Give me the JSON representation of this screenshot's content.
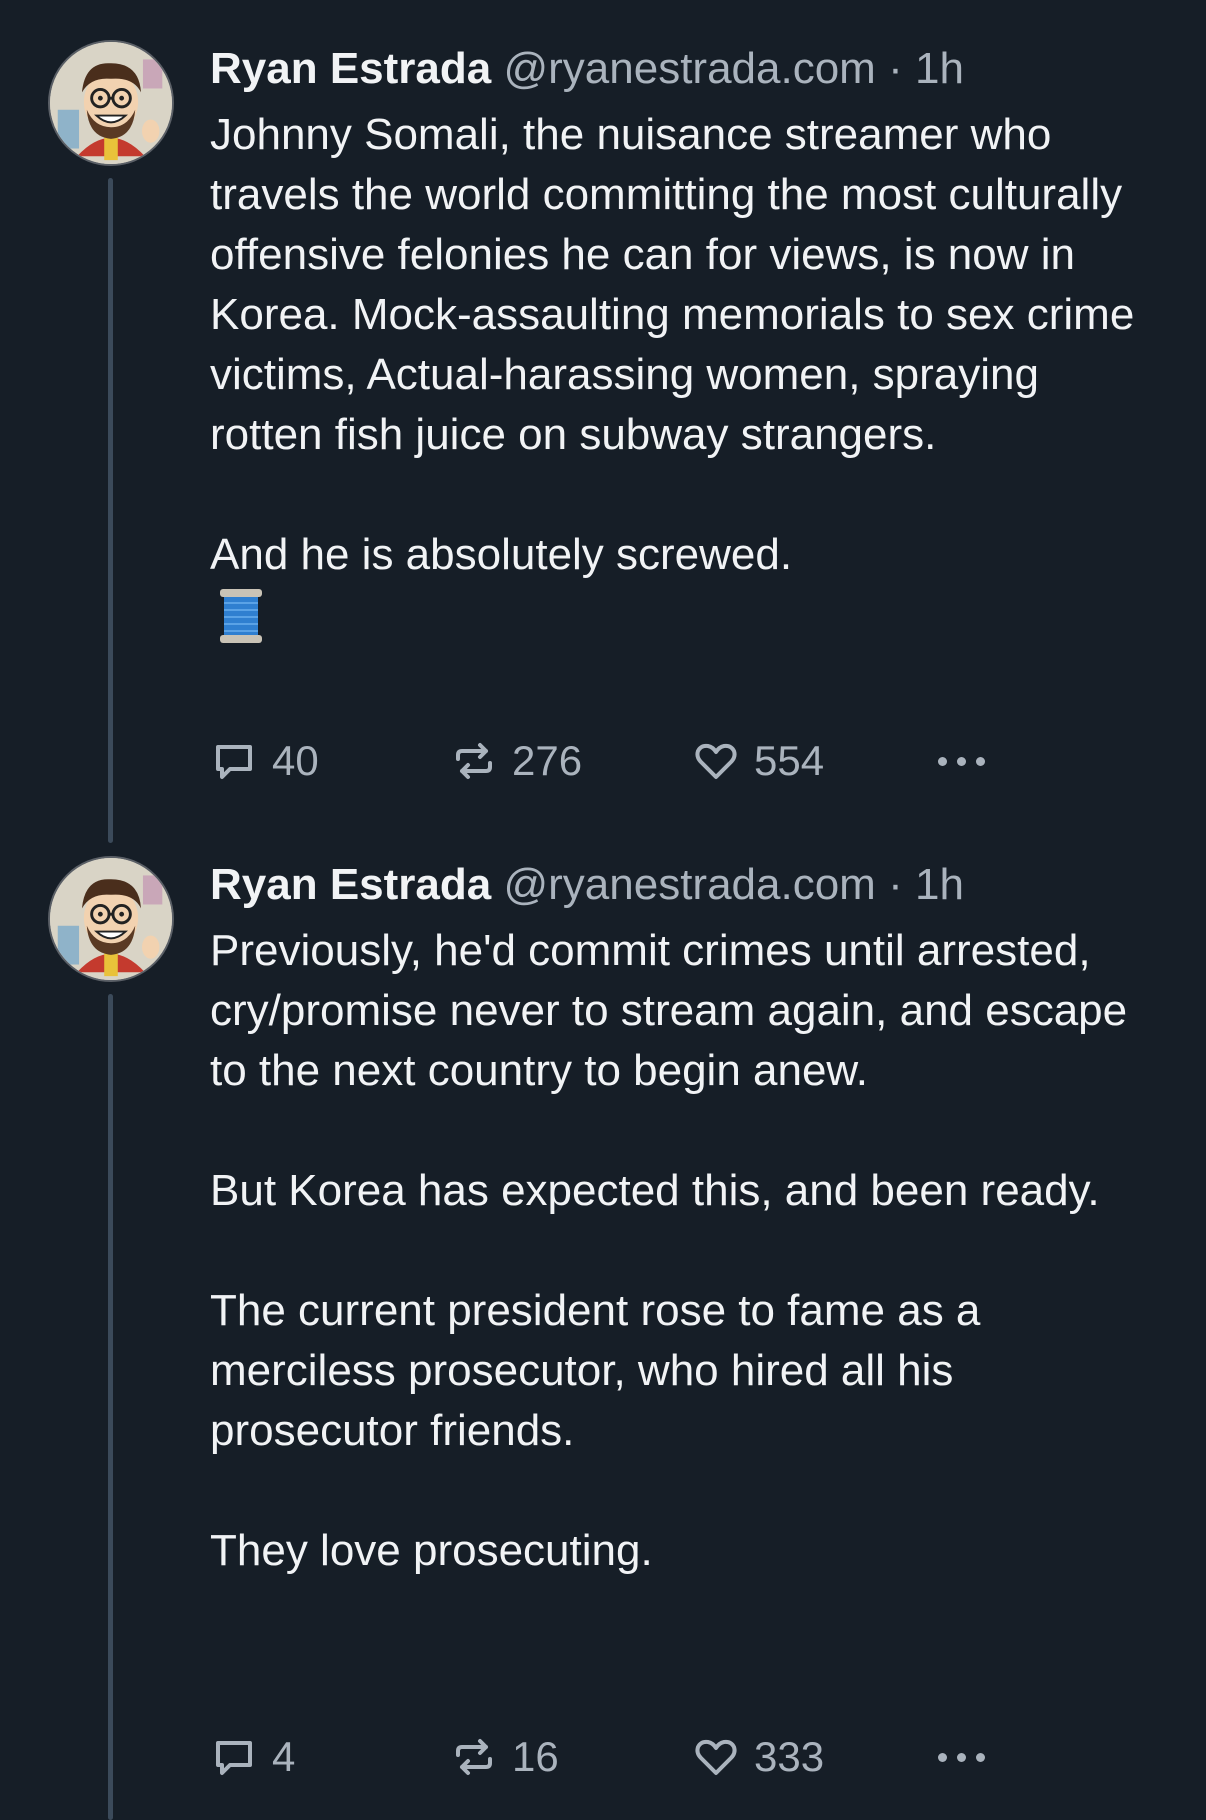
{
  "posts": [
    {
      "author_name": "Ryan Estrada",
      "handle": "@ryanestrada.com",
      "separator": "·",
      "time": "1h",
      "paragraphs": [
        "Johnny Somali, the nuisance streamer who travels the world committing the most culturally offensive felonies he can for views, is now in Korea. Mock-assaulting memorials to sex crime victims, Actual-harassing women, spraying rotten fish juice on subway strangers.",
        "And he is absolutely screwed."
      ],
      "emoji": "spool-of-thread-icon",
      "replies": "40",
      "reposts": "276",
      "likes": "554"
    },
    {
      "author_name": "Ryan Estrada",
      "handle": "@ryanestrada.com",
      "separator": "·",
      "time": "1h",
      "paragraphs": [
        "Previously, he'd commit crimes until arrested, cry/promise never to stream again, and escape to the next country to begin anew.",
        "But Korea has expected this, and been ready.",
        "The current president rose to fame as a merciless prosecutor, who hired all his prosecutor friends.",
        "They love prosecuting."
      ],
      "replies": "4",
      "reposts": "16",
      "likes": "333"
    }
  ],
  "colors": {
    "background": "#161e27",
    "text": "#f1f3f5",
    "muted": "#aab3bd",
    "thread_line": "#3b4a5a"
  }
}
